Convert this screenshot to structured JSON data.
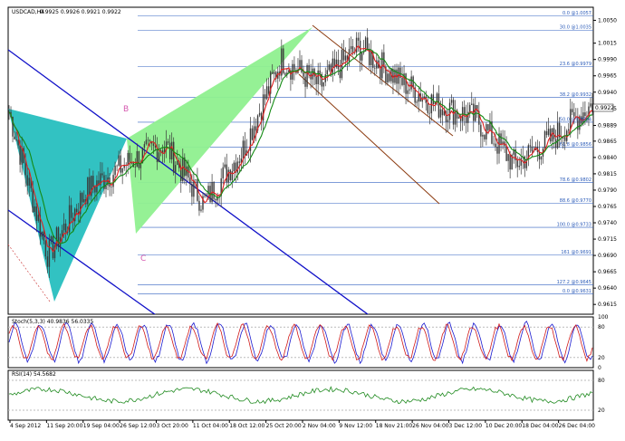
{
  "chart": {
    "title": "USDCAD,H4",
    "ohlc": "0.9925 0.9926 0.9921 0.9922",
    "current_price": "0.9922",
    "colors": {
      "candles": "#3a3a3a",
      "ma_fast": "#e02020",
      "ma_slow": "#138a13",
      "pattern_xab": "#27bfbf",
      "pattern_bcd": "#8ff08f",
      "trendline_blue": "#1010c8",
      "channel_brown": "#8b3a0f",
      "fib_line": "#3060c0",
      "stoch_main": "#1a1ad0",
      "stoch_signal": "#d01a1a",
      "rsi": "#1f8a1f"
    }
  },
  "price_axis": {
    "labels": [
      "1.0050",
      "1.0015",
      "0.9990",
      "0.9965",
      "0.9940",
      "0.9915",
      "0.9889",
      "0.9865",
      "0.9840",
      "0.9815",
      "0.9790",
      "0.9765",
      "0.9740",
      "0.9715",
      "0.9690",
      "0.9665",
      "0.9640",
      "0.9615"
    ]
  },
  "date_axis": {
    "labels": [
      "4 Sep 2012",
      "11 Sep 20:00",
      "19 Sep 04:00",
      "26 Sep 12:00",
      "3 Oct 20:00",
      "11 Oct 04:00",
      "18 Oct 12:00",
      "25 Oct 20:00",
      "2 Nov 04:00",
      "9 Nov 12:00",
      "18 Nov 21:00",
      "26 Nov 04:00",
      "3 Dec 12:00",
      "10 Dec 20:00",
      "18 Dec 04:00",
      "26 Dec 04:00"
    ]
  },
  "fib_levels": [
    {
      "label": "0.0 @1.0057"
    },
    {
      "label": "30.0 @1.0035"
    },
    {
      "label": "23.6 @0.9979"
    },
    {
      "label": "38.2 @0.9932"
    },
    {
      "label": "50.0 @0.9894"
    },
    {
      "label": "61.8 @0.9856"
    },
    {
      "label": "78.6 @0.9802"
    },
    {
      "label": "88.6 @0.9770"
    },
    {
      "label": "100.0 @0.9733"
    },
    {
      "label": "161 @0.9691"
    },
    {
      "label": "127.2 @0.9645"
    },
    {
      "label": "0.0 @0.9631"
    }
  ],
  "pattern": {
    "label_b": "B",
    "label_c": "C"
  },
  "indicators": {
    "stoch_label": "Stoch(5,3,3) 40.9836 56.0335",
    "rsi_label": "RSI(14) 54.5682",
    "stoch_axis": [
      "100",
      "80",
      "20",
      "0"
    ],
    "rsi_axis": [
      "80",
      "20"
    ]
  },
  "chart_data": {
    "type": "line",
    "title": "USDCAD,H4",
    "xlabel": "",
    "ylabel": "",
    "ylim": [
      0.96,
      1.007
    ],
    "x": [
      "4 Sep 2012",
      "11 Sep 20:00",
      "19 Sep 04:00",
      "26 Sep 12:00",
      "3 Oct 20:00",
      "11 Oct 04:00",
      "18 Oct 12:00",
      "25 Oct 20:00",
      "2 Nov 04:00",
      "9 Nov 12:00",
      "18 Nov 21:00",
      "26 Nov 04:00",
      "3 Dec 12:00",
      "10 Dec 20:00",
      "18 Dec 04:00",
      "26 Dec 04:00"
    ],
    "series": [
      {
        "values": [
          0.991,
          0.969,
          0.979,
          0.983,
          0.986,
          0.977,
          0.985,
          0.999,
          0.995,
          1.001,
          0.996,
          0.992,
          0.99,
          0.983,
          0.987,
          0.9922
        ]
      }
    ],
    "grid": true
  }
}
